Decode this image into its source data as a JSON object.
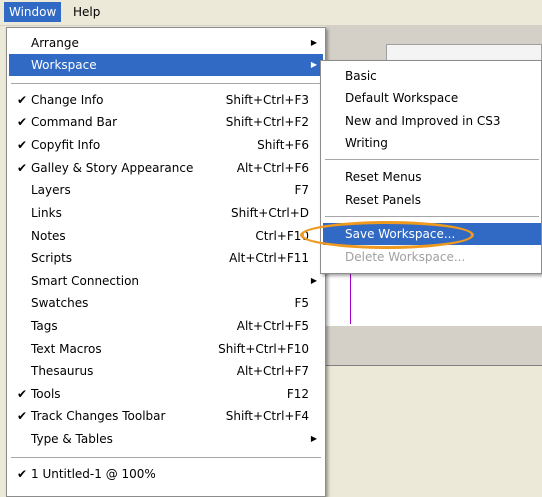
{
  "menubar": {
    "window_label": "Window",
    "help_label": "Help"
  },
  "window_menu": {
    "items": [
      {
        "label": "Arrange",
        "submenu": true
      },
      {
        "label": "Workspace",
        "submenu": true,
        "highlighted": true
      },
      {
        "label": "Change Info",
        "checked": true,
        "shortcut": "Shift+Ctrl+F3"
      },
      {
        "label": "Command Bar",
        "checked": true,
        "shortcut": "Shift+Ctrl+F2"
      },
      {
        "label": "Copyfit Info",
        "checked": true,
        "shortcut": "Shift+F6"
      },
      {
        "label": "Galley & Story Appearance",
        "checked": true,
        "shortcut": "Alt+Ctrl+F6"
      },
      {
        "label": "Layers",
        "shortcut": "F7"
      },
      {
        "label": "Links",
        "shortcut": "Shift+Ctrl+D"
      },
      {
        "label": "Notes",
        "shortcut": "Ctrl+F10"
      },
      {
        "label": "Scripts",
        "shortcut": "Alt+Ctrl+F11"
      },
      {
        "label": "Smart Connection",
        "submenu": true
      },
      {
        "label": "Swatches",
        "shortcut": "F5"
      },
      {
        "label": "Tags",
        "shortcut": "Alt+Ctrl+F5"
      },
      {
        "label": "Text Macros",
        "shortcut": "Shift+Ctrl+F10"
      },
      {
        "label": "Thesaurus",
        "shortcut": "Alt+Ctrl+F7"
      },
      {
        "label": "Tools",
        "checked": true,
        "shortcut": "F12"
      },
      {
        "label": "Track Changes Toolbar",
        "checked": true,
        "shortcut": "Shift+Ctrl+F4"
      },
      {
        "label": "Type & Tables",
        "submenu": true
      },
      {
        "label": "1 Untitled-1 @ 100%",
        "checked": true
      }
    ]
  },
  "workspace_submenu": {
    "items": [
      {
        "label": "Basic"
      },
      {
        "label": "Default Workspace"
      },
      {
        "label": "New and Improved in CS3"
      },
      {
        "label": "Writing"
      },
      {
        "label": "Reset Menus"
      },
      {
        "label": "Reset Panels"
      },
      {
        "label": "Save Workspace...",
        "highlighted": true
      },
      {
        "label": "Delete Workspace...",
        "disabled": true
      }
    ]
  },
  "icons": {
    "check": "checkmark-icon",
    "arrow": "submenu-arrow-icon"
  },
  "colors": {
    "highlight": "#316ac5",
    "annotation_ring": "#ef9a1e"
  }
}
